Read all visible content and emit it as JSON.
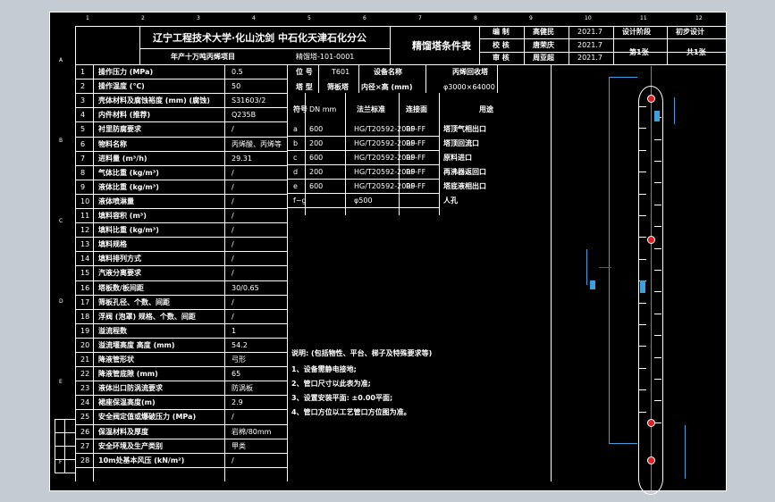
{
  "title_block": {
    "company": "辽宁工程技术大学·化山沈剑 中石化天津石化分公",
    "project": "年产十万吨丙烯项目",
    "drawing_no": "精馏塔-101-0001",
    "doc_title": "精馏塔条件表",
    "roles": [
      {
        "role": "编 制",
        "name": "高健民",
        "date": "2021.7"
      },
      {
        "role": "校 核",
        "name": "唐荣庆",
        "date": "2021.7"
      },
      {
        "role": "审 核",
        "name": "周亚超",
        "date": "2021.7"
      }
    ],
    "stage_label": "设计阶段",
    "stage_value": "初步设计",
    "sheet_label": "第1张",
    "sheets_label": "共1张"
  },
  "equipment": {
    "tag_label": "位 号",
    "tag_value": "T601",
    "name_label": "设备名称",
    "name_value": "丙烯回收塔",
    "type_label": "塔 型",
    "type_value": "筛板塔",
    "dims_label": "内径×高 (mm)",
    "dims_value": "φ3000×64000"
  },
  "nozzle_headers": {
    "symbol": "符号",
    "dn": "DN mm",
    "standard": "法兰标准",
    "face": "连接面",
    "use": "用途"
  },
  "nozzles": [
    {
      "symbol": "a",
      "dn": "600",
      "standard": "HG/T20592-2009",
      "face": "RF-FF",
      "use": "塔顶气相出口"
    },
    {
      "symbol": "b",
      "dn": "200",
      "standard": "HG/T20592-2009",
      "face": "RF-FF",
      "use": "塔顶回流口"
    },
    {
      "symbol": "c",
      "dn": "600",
      "standard": "HG/T20592-2009",
      "face": "RF-FF",
      "use": "原料进口"
    },
    {
      "symbol": "d",
      "dn": "200",
      "standard": "HG/T20592-2009",
      "face": "RF-FF",
      "use": "再沸器返回口"
    },
    {
      "symbol": "e",
      "dn": "600",
      "standard": "HG/T20592-2009",
      "face": "RF-FF",
      "use": "塔底液相出口"
    },
    {
      "symbol": "f~g",
      "dn": "",
      "standard": "φ500",
      "face": "",
      "use": "人孔"
    }
  ],
  "conditions": [
    {
      "no": "1",
      "item": "操作压力 (MPa)",
      "value": "0.5"
    },
    {
      "no": "2",
      "item": "操作温度 (℃)",
      "value": "50"
    },
    {
      "no": "3",
      "item": "壳体材料及腐蚀裕度 (mm) (腐蚀)",
      "value": "S31603/2"
    },
    {
      "no": "4",
      "item": "内件材料 (推荐)",
      "value": "Q235B"
    },
    {
      "no": "5",
      "item": "衬里防腐要求",
      "value": "/"
    },
    {
      "no": "6",
      "item": "物料名称",
      "value": "丙烯酸、丙烯等"
    },
    {
      "no": "7",
      "item": "进料量 (m³/h)",
      "value": "29.31"
    },
    {
      "no": "8",
      "item": "气体比重 (kg/m³)",
      "value": "/"
    },
    {
      "no": "9",
      "item": "液体比重 (kg/m³)",
      "value": "/"
    },
    {
      "no": "10",
      "item": "液体喷淋量",
      "value": "/"
    },
    {
      "no": "11",
      "item": "填料容积 (m³)",
      "value": "/"
    },
    {
      "no": "12",
      "item": "填料比重 (kg/m³)",
      "value": "/"
    },
    {
      "no": "13",
      "item": "填料规格",
      "value": "/"
    },
    {
      "no": "14",
      "item": "填料排列方式",
      "value": "/"
    },
    {
      "no": "15",
      "item": "汽液分离要求",
      "value": "/"
    },
    {
      "no": "16",
      "item": "塔板数/板间距",
      "value": "30/0.65"
    },
    {
      "no": "17",
      "item": "筛板孔径、个数、间距",
      "value": "/"
    },
    {
      "no": "18",
      "item": "浮阀 (泡罩) 规格、个数、间距",
      "value": "/"
    },
    {
      "no": "19",
      "item": "溢流程数",
      "value": "1"
    },
    {
      "no": "20",
      "item": "溢流堰高度 高度 (mm)",
      "value": "54.2"
    },
    {
      "no": "21",
      "item": "降液管形状",
      "value": "弓形"
    },
    {
      "no": "22",
      "item": "降液管底隙 (mm)",
      "value": "65"
    },
    {
      "no": "23",
      "item": "液体出口防涡流要求",
      "value": "防涡板"
    },
    {
      "no": "24",
      "item": "裙座保温高度(m)",
      "value": "2.9"
    },
    {
      "no": "25",
      "item": "安全阀定值或爆破压力 (MPa)",
      "value": "/"
    },
    {
      "no": "26",
      "item": "保温材料及厚度",
      "value": "岩棉/80mm"
    },
    {
      "no": "27",
      "item": "安全环境及生产类别",
      "value": "甲类"
    },
    {
      "no": "28",
      "item": "10m处基本风压 (kN/m²)",
      "value": "/"
    }
  ],
  "notes": {
    "header": "说明: (包括物性、平台、梯子及特殊要求等)",
    "lines": [
      "1、设备需静电接地;",
      "2、管口尺寸以此表为准;",
      "3、设置安装平面: ±0.00平面;",
      "4、管口方位以工艺管口方位图为准。"
    ]
  },
  "ruler_cols": [
    "1",
    "2",
    "3",
    "4",
    "5",
    "6",
    "7",
    "8",
    "9",
    "10",
    "11",
    "12"
  ],
  "ruler_rows": [
    "A",
    "B",
    "C",
    "D",
    "E",
    "F"
  ]
}
